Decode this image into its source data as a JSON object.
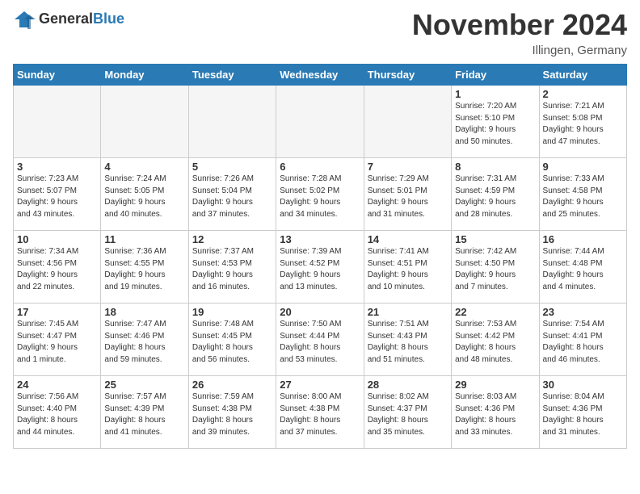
{
  "header": {
    "title": "November 2024",
    "location": "Illingen, Germany",
    "logo_general": "General",
    "logo_blue": "Blue"
  },
  "days_of_week": [
    "Sunday",
    "Monday",
    "Tuesday",
    "Wednesday",
    "Thursday",
    "Friday",
    "Saturday"
  ],
  "weeks": [
    [
      {
        "day": "",
        "info": "",
        "empty": true
      },
      {
        "day": "",
        "info": "",
        "empty": true
      },
      {
        "day": "",
        "info": "",
        "empty": true
      },
      {
        "day": "",
        "info": "",
        "empty": true
      },
      {
        "day": "",
        "info": "",
        "empty": true
      },
      {
        "day": "1",
        "info": "Sunrise: 7:20 AM\nSunset: 5:10 PM\nDaylight: 9 hours\nand 50 minutes."
      },
      {
        "day": "2",
        "info": "Sunrise: 7:21 AM\nSunset: 5:08 PM\nDaylight: 9 hours\nand 47 minutes."
      }
    ],
    [
      {
        "day": "3",
        "info": "Sunrise: 7:23 AM\nSunset: 5:07 PM\nDaylight: 9 hours\nand 43 minutes."
      },
      {
        "day": "4",
        "info": "Sunrise: 7:24 AM\nSunset: 5:05 PM\nDaylight: 9 hours\nand 40 minutes."
      },
      {
        "day": "5",
        "info": "Sunrise: 7:26 AM\nSunset: 5:04 PM\nDaylight: 9 hours\nand 37 minutes."
      },
      {
        "day": "6",
        "info": "Sunrise: 7:28 AM\nSunset: 5:02 PM\nDaylight: 9 hours\nand 34 minutes."
      },
      {
        "day": "7",
        "info": "Sunrise: 7:29 AM\nSunset: 5:01 PM\nDaylight: 9 hours\nand 31 minutes."
      },
      {
        "day": "8",
        "info": "Sunrise: 7:31 AM\nSunset: 4:59 PM\nDaylight: 9 hours\nand 28 minutes."
      },
      {
        "day": "9",
        "info": "Sunrise: 7:33 AM\nSunset: 4:58 PM\nDaylight: 9 hours\nand 25 minutes."
      }
    ],
    [
      {
        "day": "10",
        "info": "Sunrise: 7:34 AM\nSunset: 4:56 PM\nDaylight: 9 hours\nand 22 minutes."
      },
      {
        "day": "11",
        "info": "Sunrise: 7:36 AM\nSunset: 4:55 PM\nDaylight: 9 hours\nand 19 minutes."
      },
      {
        "day": "12",
        "info": "Sunrise: 7:37 AM\nSunset: 4:53 PM\nDaylight: 9 hours\nand 16 minutes."
      },
      {
        "day": "13",
        "info": "Sunrise: 7:39 AM\nSunset: 4:52 PM\nDaylight: 9 hours\nand 13 minutes."
      },
      {
        "day": "14",
        "info": "Sunrise: 7:41 AM\nSunset: 4:51 PM\nDaylight: 9 hours\nand 10 minutes."
      },
      {
        "day": "15",
        "info": "Sunrise: 7:42 AM\nSunset: 4:50 PM\nDaylight: 9 hours\nand 7 minutes."
      },
      {
        "day": "16",
        "info": "Sunrise: 7:44 AM\nSunset: 4:48 PM\nDaylight: 9 hours\nand 4 minutes."
      }
    ],
    [
      {
        "day": "17",
        "info": "Sunrise: 7:45 AM\nSunset: 4:47 PM\nDaylight: 9 hours\nand 1 minute."
      },
      {
        "day": "18",
        "info": "Sunrise: 7:47 AM\nSunset: 4:46 PM\nDaylight: 8 hours\nand 59 minutes."
      },
      {
        "day": "19",
        "info": "Sunrise: 7:48 AM\nSunset: 4:45 PM\nDaylight: 8 hours\nand 56 minutes."
      },
      {
        "day": "20",
        "info": "Sunrise: 7:50 AM\nSunset: 4:44 PM\nDaylight: 8 hours\nand 53 minutes."
      },
      {
        "day": "21",
        "info": "Sunrise: 7:51 AM\nSunset: 4:43 PM\nDaylight: 8 hours\nand 51 minutes."
      },
      {
        "day": "22",
        "info": "Sunrise: 7:53 AM\nSunset: 4:42 PM\nDaylight: 8 hours\nand 48 minutes."
      },
      {
        "day": "23",
        "info": "Sunrise: 7:54 AM\nSunset: 4:41 PM\nDaylight: 8 hours\nand 46 minutes."
      }
    ],
    [
      {
        "day": "24",
        "info": "Sunrise: 7:56 AM\nSunset: 4:40 PM\nDaylight: 8 hours\nand 44 minutes."
      },
      {
        "day": "25",
        "info": "Sunrise: 7:57 AM\nSunset: 4:39 PM\nDaylight: 8 hours\nand 41 minutes."
      },
      {
        "day": "26",
        "info": "Sunrise: 7:59 AM\nSunset: 4:38 PM\nDaylight: 8 hours\nand 39 minutes."
      },
      {
        "day": "27",
        "info": "Sunrise: 8:00 AM\nSunset: 4:38 PM\nDaylight: 8 hours\nand 37 minutes."
      },
      {
        "day": "28",
        "info": "Sunrise: 8:02 AM\nSunset: 4:37 PM\nDaylight: 8 hours\nand 35 minutes."
      },
      {
        "day": "29",
        "info": "Sunrise: 8:03 AM\nSunset: 4:36 PM\nDaylight: 8 hours\nand 33 minutes."
      },
      {
        "day": "30",
        "info": "Sunrise: 8:04 AM\nSunset: 4:36 PM\nDaylight: 8 hours\nand 31 minutes."
      }
    ]
  ]
}
